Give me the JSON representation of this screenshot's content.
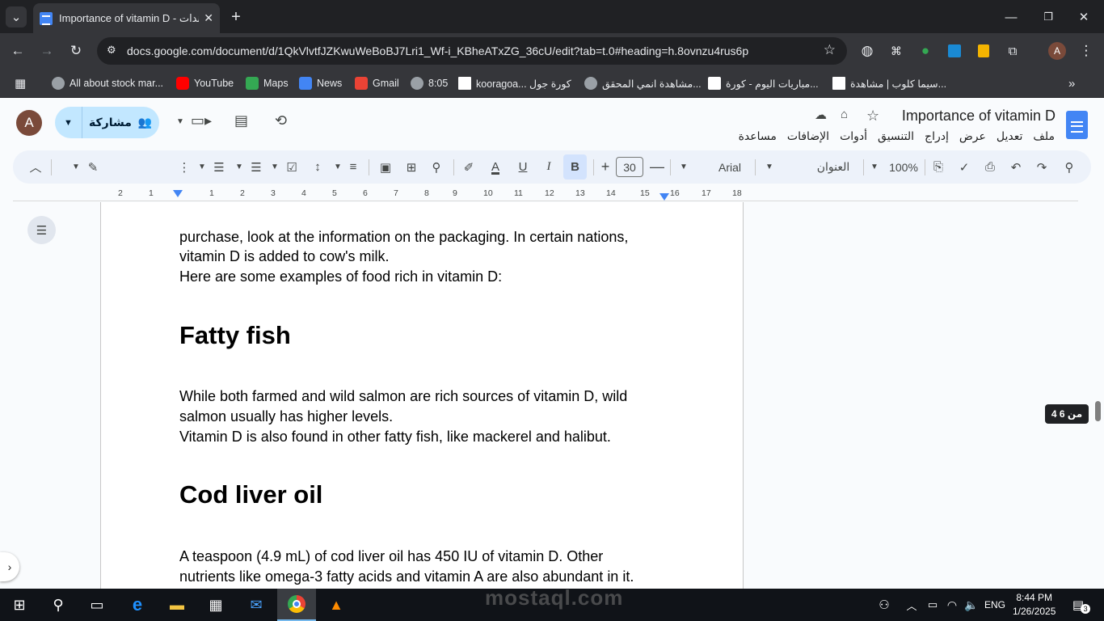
{
  "browser": {
    "tab_title": "Importance of vitamin D - مُستندات",
    "url": "docs.google.com/document/d/1QkVlvtfJZKwuWeBoBJ7Lri1_Wf-i_KBheATxZG_36cU/edit?tab=t.0#heading=h.8ovnzu4rus6p",
    "bookmarks": [
      {
        "label": "All about stock mar...",
        "color": "#9aa0a6"
      },
      {
        "label": "YouTube",
        "color": "#ff0000"
      },
      {
        "label": "Maps",
        "color": "#34a853"
      },
      {
        "label": "News",
        "color": "#4285f4"
      },
      {
        "label": "Gmail",
        "color": "#ea4335"
      },
      {
        "label": "8:05",
        "color": "#9aa0a6"
      },
      {
        "label": "kooragoa... كورة جول",
        "color": "#ffffff"
      },
      {
        "label": "مشاهدة انمي المحقق...",
        "color": "#9aa0a6"
      },
      {
        "label": "مباريات اليوم - كورة...",
        "color": "#ffffff"
      },
      {
        "label": "سيما كلوب | مشاهدة...",
        "color": "#ffffff"
      }
    ]
  },
  "docs": {
    "title": "Importance of vitamin D",
    "avatar_letter": "A",
    "share_label": "مشاركة",
    "menus": [
      "ملف",
      "تعديل",
      "عرض",
      "إدراج",
      "التنسيق",
      "أدوات",
      "الإضافات",
      "مساعدة"
    ],
    "toolbar": {
      "zoom": "100%",
      "style": "العنوان",
      "font": "Arial",
      "font_size": "30"
    },
    "ruler_numbers": [
      "2",
      "1",
      "1",
      "2",
      "3",
      "4",
      "5",
      "6",
      "7",
      "8",
      "9",
      "10",
      "11",
      "12",
      "13",
      "14",
      "15",
      "16",
      "17",
      "18"
    ],
    "page_indicator": "4 من 6"
  },
  "content": {
    "p1": "purchase, look at the information on the packaging. In certain nations,",
    "p2": "vitamin D is added to cow's milk.",
    "p3": "Here are some examples of food rich in vitamin D:",
    "h1": "Fatty fish",
    "p4": "While both farmed and wild salmon are rich sources of vitamin D, wild",
    "p5": "salmon usually has higher levels.",
    "p6": "Vitamin D is also found in other fatty fish, like mackerel and halibut.",
    "h2": "Cod liver oil",
    "p7": "A teaspoon (4.9 mL) of cod liver oil has 450 IU of vitamin D. Other",
    "p8": "nutrients like omega-3 fatty acids and vitamin A are also abundant in it."
  },
  "taskbar": {
    "time": "8:44 PM",
    "date": "1/26/2025",
    "lang": "ENG",
    "notif_count": "3"
  },
  "watermark": "mostaql.com"
}
